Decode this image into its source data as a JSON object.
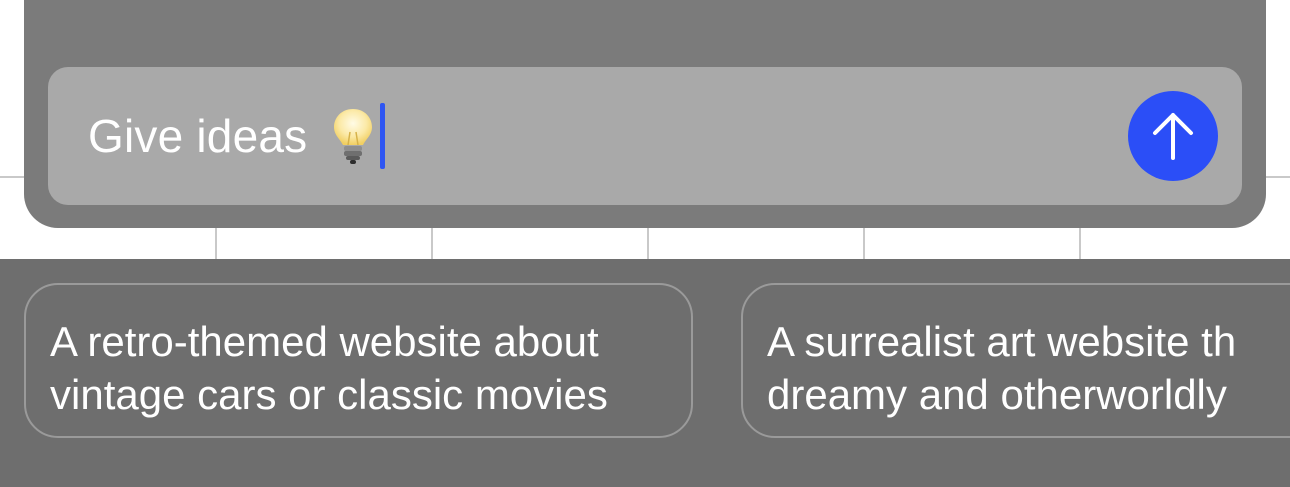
{
  "composer": {
    "input_text": "Give ideas",
    "send_button_icon": "arrow-up-icon",
    "lightbulb_icon": "lightbulb-icon"
  },
  "suggestions": [
    {
      "line1": "A retro-themed website about",
      "line2": "vintage cars or classic movies"
    },
    {
      "line1": "A surrealist art website th",
      "line2": "dreamy and otherworldly"
    }
  ],
  "colors": {
    "accent": "#2b4ef7",
    "caret": "#2f56f2",
    "composer_bg": "#7b7b7b",
    "input_bg": "#a9a9a9",
    "suggestions_bg": "#6e6e6e"
  }
}
